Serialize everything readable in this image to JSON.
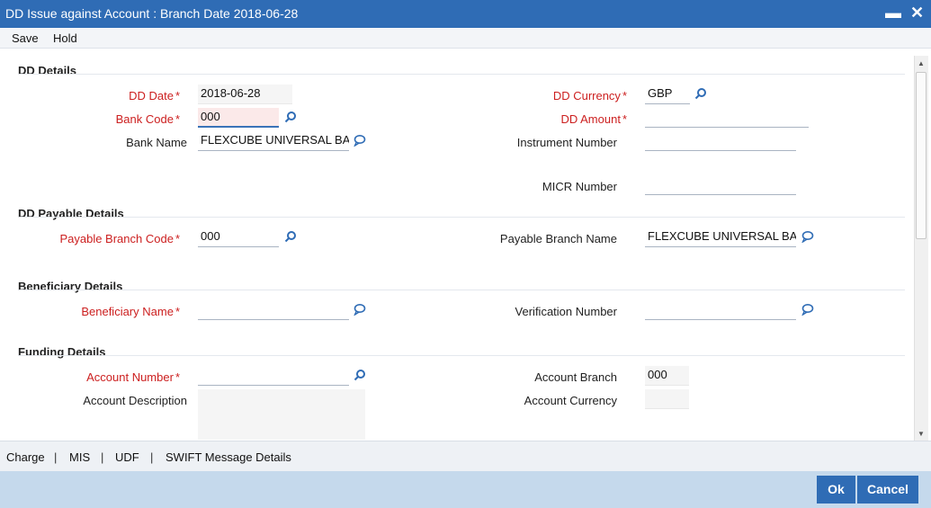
{
  "window": {
    "title": "DD Issue against Account : Branch Date 2018-06-28",
    "minimize": "▬",
    "close": "✕"
  },
  "toolbar": {
    "save": "Save",
    "hold": "Hold"
  },
  "sections": {
    "dd_details": "DD Details",
    "payable": "DD Payable Details",
    "beneficiary": "Beneficiary Details",
    "funding": "Funding Details"
  },
  "dd": {
    "dd_date_label": "DD Date",
    "dd_date": "2018-06-28",
    "bank_code_label": "Bank Code",
    "bank_code": "000",
    "bank_name_label": "Bank Name",
    "bank_name": "FLEXCUBE UNIVERSAL BA",
    "currency_label": "DD Currency",
    "currency": "GBP",
    "amount_label": "DD Amount",
    "amount": "",
    "instrument_label": "Instrument Number",
    "instrument": "",
    "micr_label": "MICR Number",
    "micr": ""
  },
  "payable": {
    "branch_code_label": "Payable Branch Code",
    "branch_code": "000",
    "branch_name_label": "Payable Branch Name",
    "branch_name": "FLEXCUBE UNIVERSAL BA"
  },
  "beneficiary": {
    "name_label": "Beneficiary Name",
    "name": "",
    "verification_label": "Verification Number",
    "verification": ""
  },
  "funding": {
    "account_number_label": "Account Number",
    "account_number": "",
    "account_description_label": "Account Description",
    "account_description": "",
    "account_branch_label": "Account Branch",
    "account_branch": "000",
    "account_currency_label": "Account Currency",
    "account_currency": ""
  },
  "required_star": "*",
  "tabs": [
    "Charge",
    "MIS",
    "UDF",
    "SWIFT Message Details"
  ],
  "tab_separator": "|",
  "footer": {
    "ok": "Ok",
    "cancel": "Cancel"
  },
  "colors": {
    "title_bar": "#2f6cb5",
    "required": "#cc1f1f",
    "footer": "#c5d9ec"
  }
}
